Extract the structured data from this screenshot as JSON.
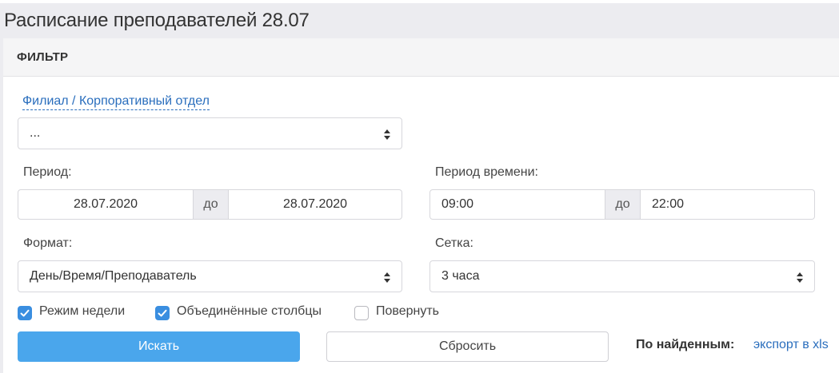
{
  "page": {
    "title": "Расписание преподавателей 28.07"
  },
  "filter": {
    "header": "ФИЛЬТР",
    "branch": {
      "label": "Филиал / Корпоративный отдел",
      "value": "..."
    },
    "period": {
      "label": "Период:",
      "from": "28.07.2020",
      "sep": "до",
      "to": "28.07.2020"
    },
    "time_period": {
      "label": "Период времени:",
      "from": "09:00",
      "sep": "до",
      "to": "22:00"
    },
    "format": {
      "label": "Формат:",
      "value": "День/Время/Преподаватель"
    },
    "grid": {
      "label": "Сетка:",
      "value": "3 часа"
    },
    "checkboxes": [
      {
        "label": "Режим недели",
        "checked": true
      },
      {
        "label": "Объединённые столбцы",
        "checked": true
      },
      {
        "label": "Повернуть",
        "checked": false
      }
    ],
    "search_label": "Искать",
    "reset_label": "Сбросить",
    "found_label": "По найденным:",
    "export_label": "экспорт в xls"
  },
  "colors": {
    "primary": "#4aa6ec",
    "link": "#2a6ebd",
    "checkbox": "#3a8ee0"
  },
  "icons": {
    "select_arrows": "sort-arrows-icon",
    "check": "check-icon"
  }
}
